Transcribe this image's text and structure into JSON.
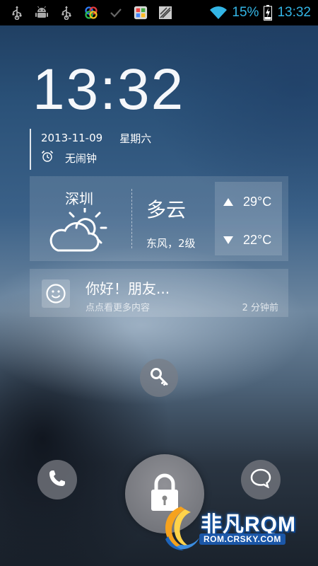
{
  "status_bar": {
    "left_icons": [
      "usb-icon",
      "android-debug-icon",
      "usb-icon",
      "app-notification-icon",
      "check-icon",
      "photo-icon",
      "screenshot-icon"
    ],
    "wifi_icon": "wifi-icon",
    "battery_percent": "15%",
    "battery_icon": "battery-charging-icon",
    "time": "13:32",
    "accent_color": "#33b5e5"
  },
  "lockscreen": {
    "clock": "13:32",
    "date": "2013-11-09",
    "weekday": "星期六",
    "alarm_icon": "alarm-clock-icon",
    "alarm_text": "无闹钟"
  },
  "weather": {
    "city": "深圳",
    "icon": "partly-cloudy-icon",
    "condition": "多云",
    "wind": "东风，2级",
    "high_temp": "29°C",
    "low_temp": "22°C"
  },
  "message": {
    "avatar_icon": "smiley-icon",
    "title": "你好！朋友...",
    "subtitle": "点点看更多内容",
    "time": "2 分钟前"
  },
  "actions": {
    "search_icon": "key-search-icon",
    "phone_icon": "phone-icon",
    "unlock_icon": "padlock-icon",
    "chat_icon": "chat-bubble-icon"
  },
  "watermark": {
    "logo_text": "非凡RQM",
    "url": "ROM.CRSKY.COM"
  }
}
